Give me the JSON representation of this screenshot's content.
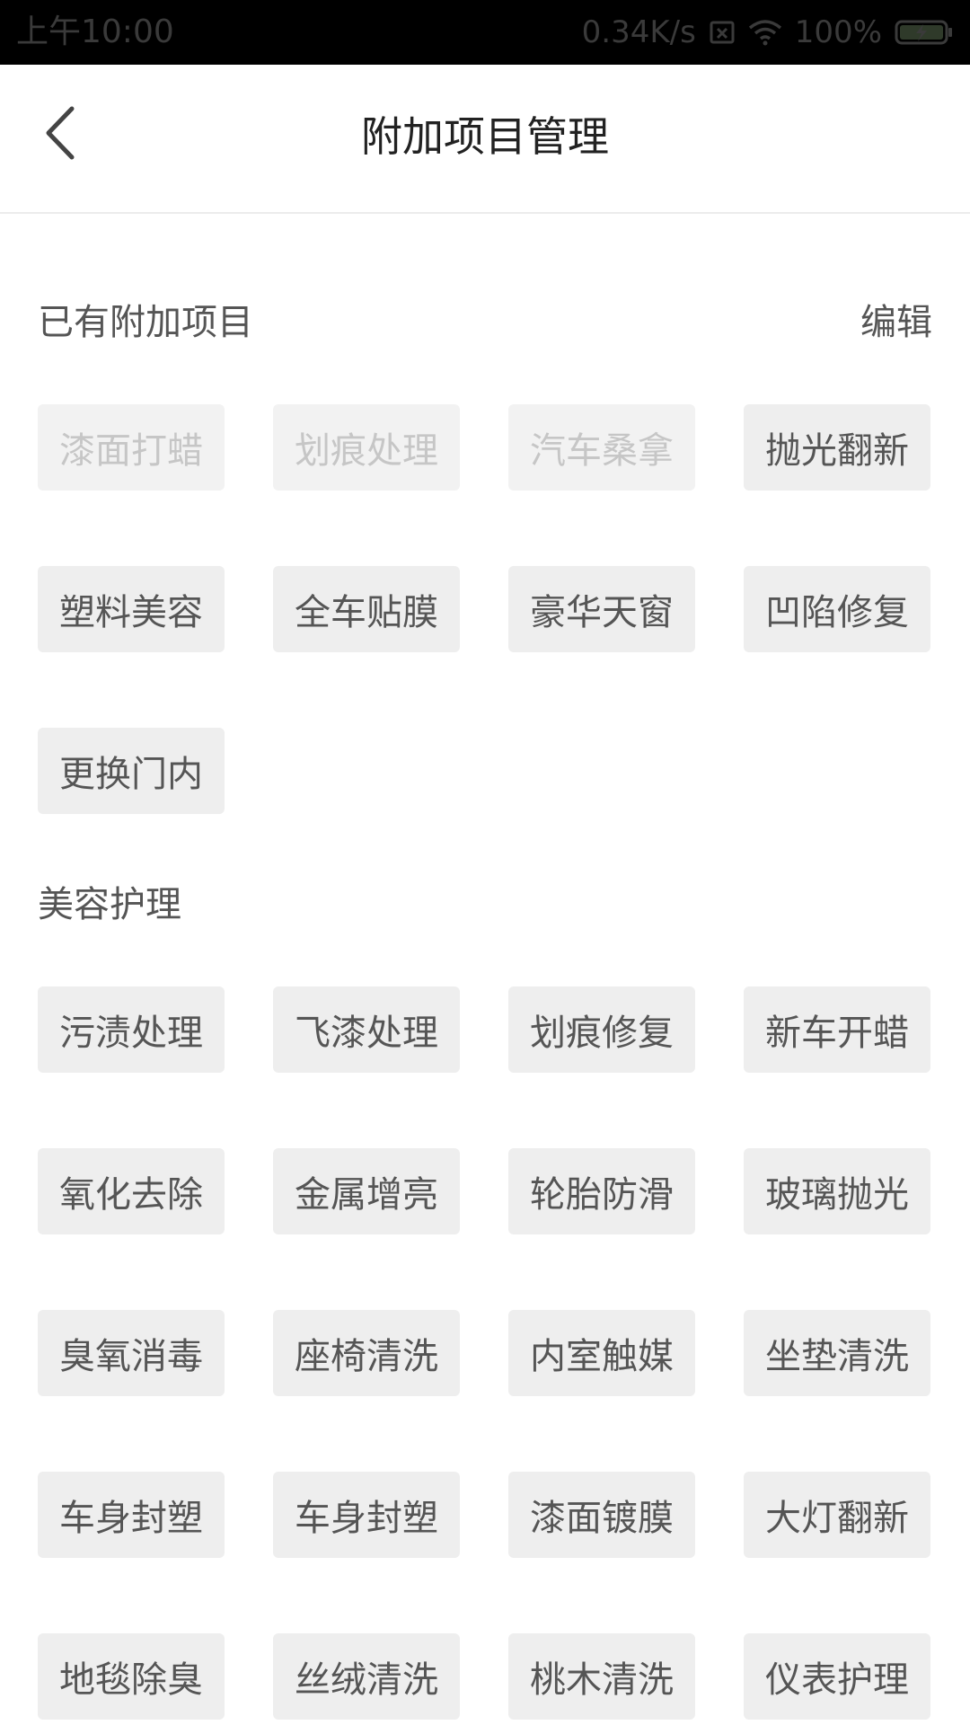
{
  "status_bar": {
    "time": "上午10:00",
    "network_speed": "0.34K/s",
    "battery": "100%",
    "icons": [
      "sim-card-x-icon",
      "wifi-icon",
      "battery-charging-icon"
    ]
  },
  "header": {
    "back_icon": "chevron-left-icon",
    "title": "附加项目管理"
  },
  "existing_section": {
    "title": "已有附加项目",
    "action_label": "编辑",
    "items": [
      {
        "label": "漆面打蜡",
        "disabled": true
      },
      {
        "label": "划痕处理",
        "disabled": true
      },
      {
        "label": "汽车桑拿",
        "disabled": true
      },
      {
        "label": "抛光翻新",
        "disabled": false
      },
      {
        "label": "塑料美容",
        "disabled": false
      },
      {
        "label": "全车贴膜",
        "disabled": false
      },
      {
        "label": "豪华天窗",
        "disabled": false
      },
      {
        "label": "凹陷修复",
        "disabled": false
      },
      {
        "label": "更换门内",
        "disabled": false
      }
    ]
  },
  "beauty_section": {
    "title": "美容护理",
    "items": [
      {
        "label": "污渍处理"
      },
      {
        "label": "飞漆处理"
      },
      {
        "label": "划痕修复"
      },
      {
        "label": "新车开蜡"
      },
      {
        "label": "氧化去除"
      },
      {
        "label": "金属增亮"
      },
      {
        "label": "轮胎防滑"
      },
      {
        "label": "玻璃抛光"
      },
      {
        "label": "臭氧消毒"
      },
      {
        "label": "座椅清洗"
      },
      {
        "label": "内室触媒"
      },
      {
        "label": "坐垫清洗"
      },
      {
        "label": "车身封塑"
      },
      {
        "label": "车身封塑"
      },
      {
        "label": "漆面镀膜"
      },
      {
        "label": "大灯翻新"
      },
      {
        "label": "地毯除臭"
      },
      {
        "label": "丝绒清洗"
      },
      {
        "label": "桃木清洗"
      },
      {
        "label": "仪表护理"
      }
    ]
  },
  "colors": {
    "status_bar_bg": "#000000",
    "chip_bg": "#eeeeee",
    "chip_text": "#555555",
    "chip_disabled_text": "#c6c6c6"
  }
}
